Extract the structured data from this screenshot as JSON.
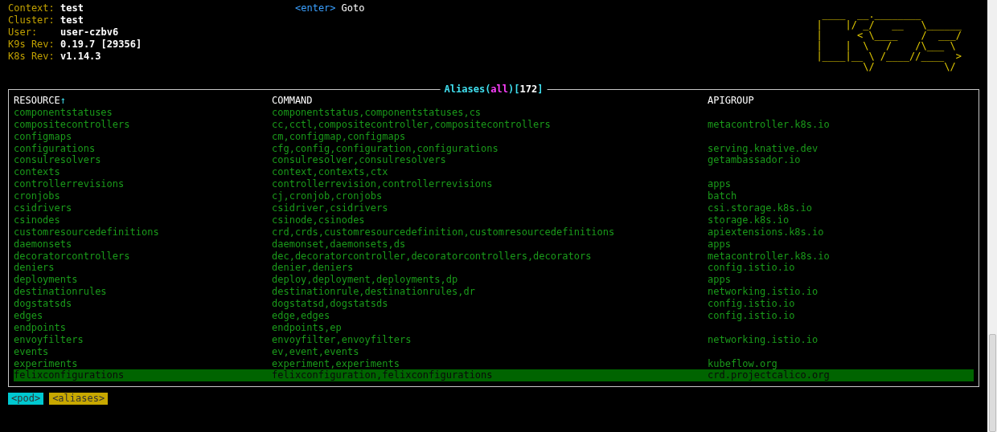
{
  "info": [
    {
      "label": "Context:",
      "value": "test"
    },
    {
      "label": "Cluster:",
      "value": "test"
    },
    {
      "label": "User:",
      "value": "user-czbv6"
    },
    {
      "label": "K9s Rev:",
      "value": "0.19.7 [29356]"
    },
    {
      "label": "K8s Rev:",
      "value": "v1.14.3"
    }
  ],
  "hints": [
    {
      "key": "<enter>",
      "action": "Goto"
    }
  ],
  "logo_lines": [
    " ____  __.________       ",
    "|    |/ _/   __   \\______",
    "|      < \\____    /  ___/",
    "|    |  \\   /    /\\___ \\ ",
    "|____|__ \\ /____//____  >",
    "        \\/            \\/ "
  ],
  "table": {
    "title": [
      {
        "text": "Aliases(",
        "kind": "label"
      },
      {
        "text": "all",
        "kind": "scope"
      },
      {
        "text": ")[",
        "kind": "label"
      },
      {
        "text": "172",
        "kind": "count"
      },
      {
        "text": "]",
        "kind": "label"
      }
    ],
    "columns": [
      {
        "label": "RESOURCE",
        "sort": "↑"
      },
      {
        "label": "COMMAND"
      },
      {
        "label": "APIGROUP"
      }
    ],
    "rows": [
      {
        "resource": "componentstatuses",
        "command": "componentstatus,componentstatuses,cs",
        "apigroup": "",
        "selected": false
      },
      {
        "resource": "compositecontrollers",
        "command": "cc,cctl,compositecontroller,compositecontrollers",
        "apigroup": "metacontroller.k8s.io",
        "selected": false
      },
      {
        "resource": "configmaps",
        "command": "cm,configmap,configmaps",
        "apigroup": "",
        "selected": false
      },
      {
        "resource": "configurations",
        "command": "cfg,config,configuration,configurations",
        "apigroup": "serving.knative.dev",
        "selected": false
      },
      {
        "resource": "consulresolvers",
        "command": "consulresolver,consulresolvers",
        "apigroup": "getambassador.io",
        "selected": false
      },
      {
        "resource": "contexts",
        "command": "context,contexts,ctx",
        "apigroup": "",
        "selected": false
      },
      {
        "resource": "controllerrevisions",
        "command": "controllerrevision,controllerrevisions",
        "apigroup": "apps",
        "selected": false
      },
      {
        "resource": "cronjobs",
        "command": "cj,cronjob,cronjobs",
        "apigroup": "batch",
        "selected": false
      },
      {
        "resource": "csidrivers",
        "command": "csidriver,csidrivers",
        "apigroup": "csi.storage.k8s.io",
        "selected": false
      },
      {
        "resource": "csinodes",
        "command": "csinode,csinodes",
        "apigroup": "storage.k8s.io",
        "selected": false
      },
      {
        "resource": "customresourcedefinitions",
        "command": "crd,crds,customresourcedefinition,customresourcedefinitions",
        "apigroup": "apiextensions.k8s.io",
        "selected": false
      },
      {
        "resource": "daemonsets",
        "command": "daemonset,daemonsets,ds",
        "apigroup": "apps",
        "selected": false
      },
      {
        "resource": "decoratorcontrollers",
        "command": "dec,decoratorcontroller,decoratorcontrollers,decorators",
        "apigroup": "metacontroller.k8s.io",
        "selected": false
      },
      {
        "resource": "deniers",
        "command": "denier,deniers",
        "apigroup": "config.istio.io",
        "selected": false
      },
      {
        "resource": "deployments",
        "command": "deploy,deployment,deployments,dp",
        "apigroup": "apps",
        "selected": false
      },
      {
        "resource": "destinationrules",
        "command": "destinationrule,destinationrules,dr",
        "apigroup": "networking.istio.io",
        "selected": false
      },
      {
        "resource": "dogstatsds",
        "command": "dogstatsd,dogstatsds",
        "apigroup": "config.istio.io",
        "selected": false
      },
      {
        "resource": "edges",
        "command": "edge,edges",
        "apigroup": "config.istio.io",
        "selected": false
      },
      {
        "resource": "endpoints",
        "command": "endpoints,ep",
        "apigroup": "",
        "selected": false
      },
      {
        "resource": "envoyfilters",
        "command": "envoyfilter,envoyfilters",
        "apigroup": "networking.istio.io",
        "selected": false
      },
      {
        "resource": "events",
        "command": "ev,event,events",
        "apigroup": "",
        "selected": false
      },
      {
        "resource": "experiments",
        "command": "experiment,experiments",
        "apigroup": "kubeflow.org",
        "selected": false
      },
      {
        "resource": "felixconfigurations",
        "command": "felixconfiguration,felixconfigurations",
        "apigroup": "crd.projectcalico.org",
        "selected": true
      }
    ]
  },
  "crumbs": [
    {
      "label": "<pod>",
      "color": "#00c8d0"
    },
    {
      "label": "<aliases>",
      "color": "#c8a800"
    }
  ]
}
